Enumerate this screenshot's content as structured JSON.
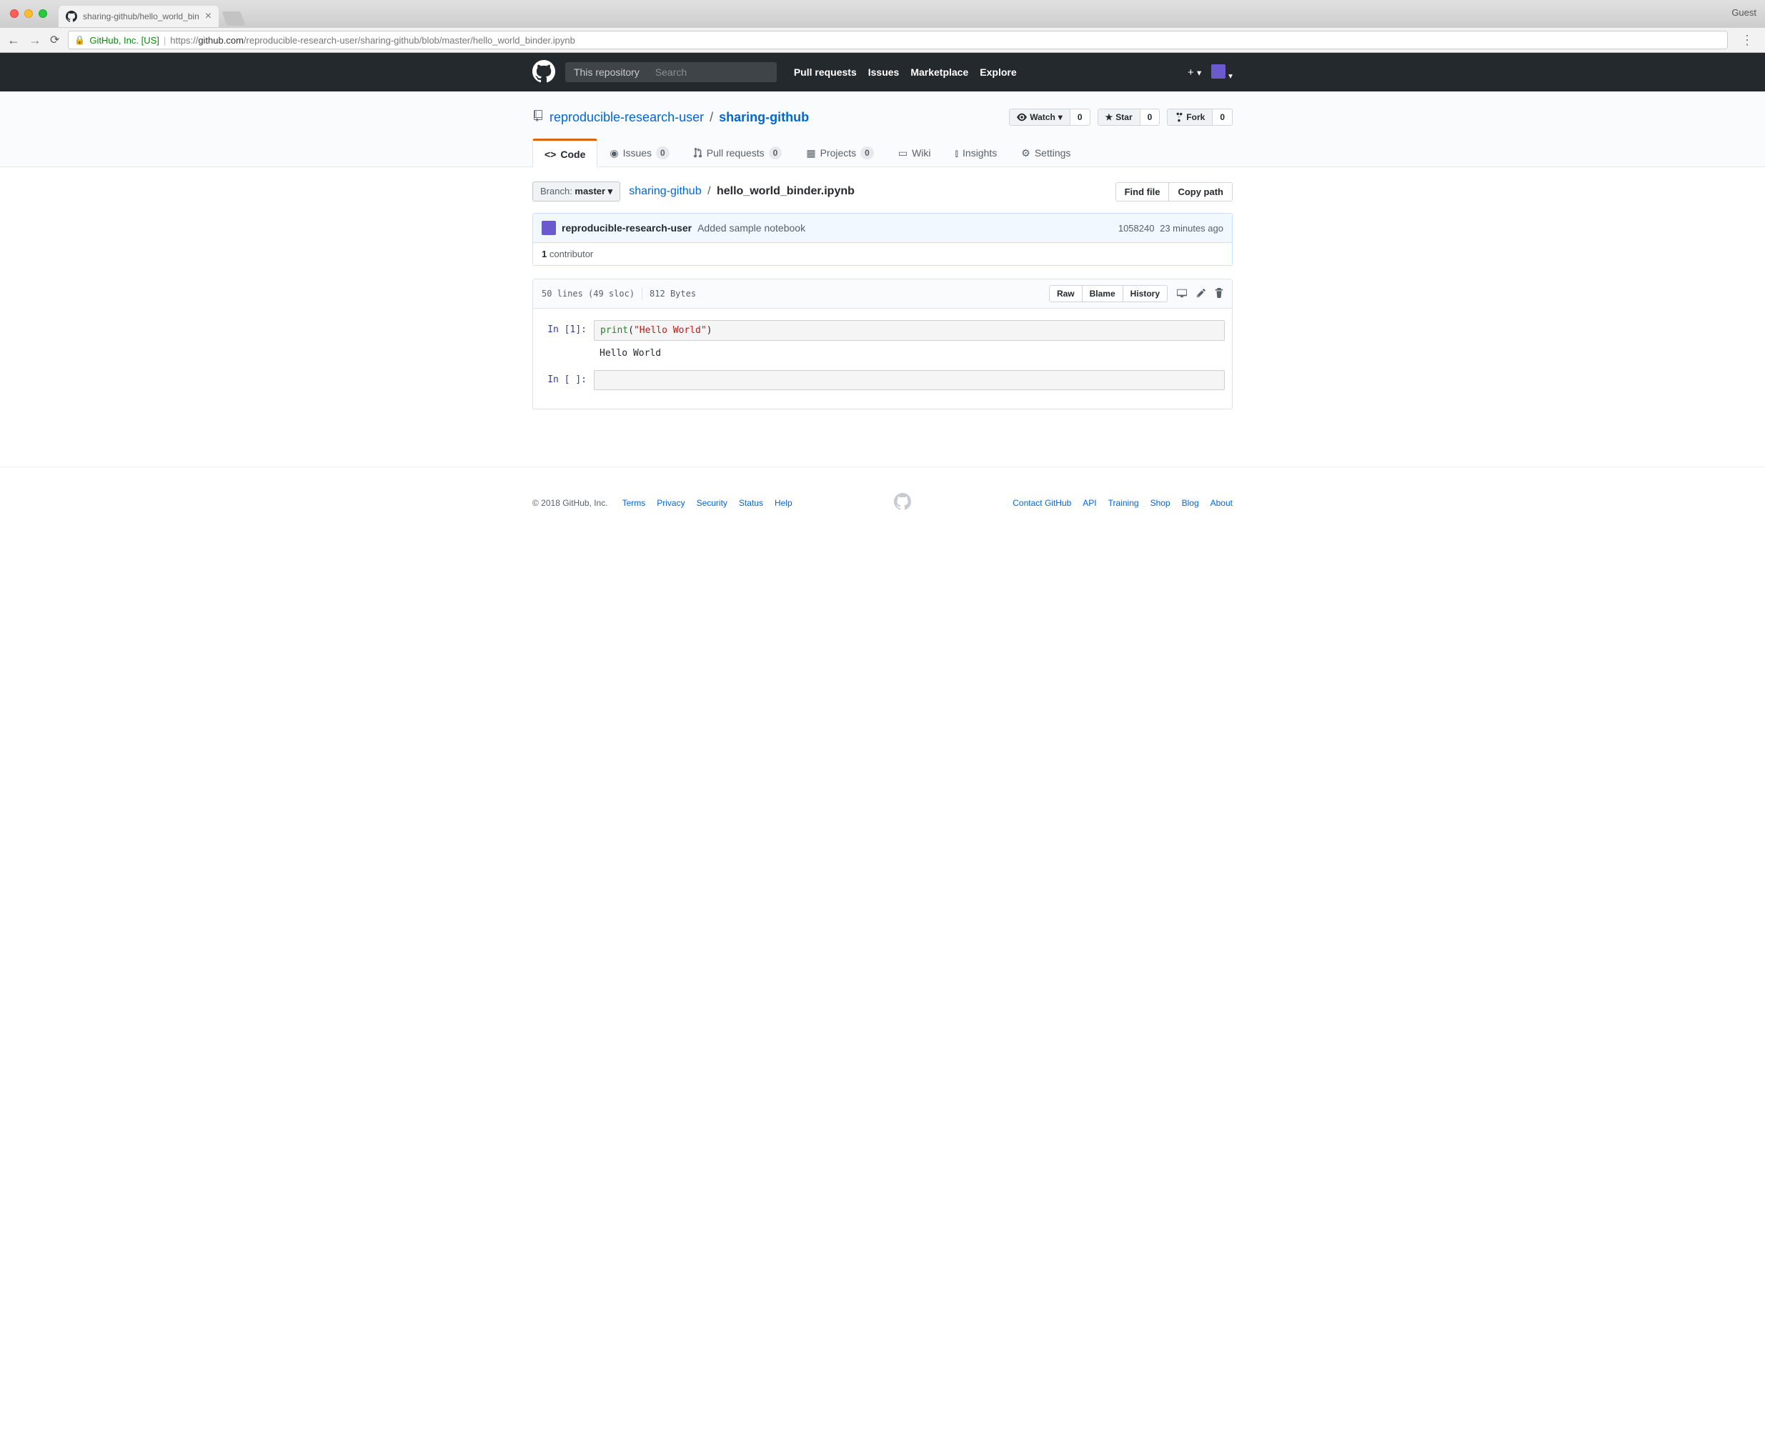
{
  "browser": {
    "tab_title": "sharing-github/hello_world_bin",
    "guest_label": "Guest",
    "url_org": "GitHub, Inc. [US]",
    "url_scheme": "https://",
    "url_host": "github.com",
    "url_path": "/reproducible-research-user/sharing-github/blob/master/hello_world_binder.ipynb"
  },
  "gh_nav": {
    "scope": "This repository",
    "search_placeholder": "Search",
    "links": [
      "Pull requests",
      "Issues",
      "Marketplace",
      "Explore"
    ]
  },
  "repo": {
    "owner": "reproducible-research-user",
    "name": "sharing-github",
    "watch_label": "Watch",
    "watch_count": "0",
    "star_label": "Star",
    "star_count": "0",
    "fork_label": "Fork",
    "fork_count": "0"
  },
  "tabs": {
    "code": "Code",
    "issues": "Issues",
    "issues_count": "0",
    "prs": "Pull requests",
    "prs_count": "0",
    "projects": "Projects",
    "projects_count": "0",
    "wiki": "Wiki",
    "insights": "Insights",
    "settings": "Settings"
  },
  "filebar": {
    "branch_prefix": "Branch: ",
    "branch_name": "master",
    "crumb_repo": "sharing-github",
    "crumb_file": "hello_world_binder.ipynb",
    "find_file": "Find file",
    "copy_path": "Copy path"
  },
  "commit": {
    "author": "reproducible-research-user",
    "message": "Added sample notebook",
    "sha": "1058240",
    "time": "23 minutes ago",
    "contrib_count": "1",
    "contrib_label": " contributor"
  },
  "filehead": {
    "lines": "50 lines (49 sloc)",
    "size": "812 Bytes",
    "raw": "Raw",
    "blame": "Blame",
    "history": "History"
  },
  "nb": {
    "prompt1": "In [1]:",
    "code_func": "print",
    "code_open": "(",
    "code_str": "\"Hello World\"",
    "code_close": ")",
    "output": "Hello World",
    "prompt2": "In [ ]:"
  },
  "footer": {
    "copyright": "© 2018 GitHub, Inc.",
    "left": [
      "Terms",
      "Privacy",
      "Security",
      "Status",
      "Help"
    ],
    "right": [
      "Contact GitHub",
      "API",
      "Training",
      "Shop",
      "Blog",
      "About"
    ]
  }
}
